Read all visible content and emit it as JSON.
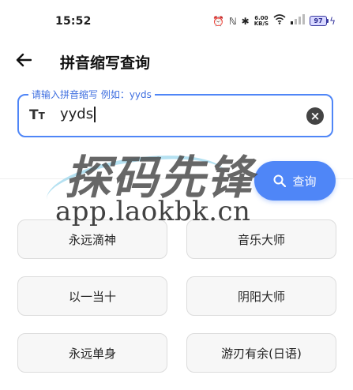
{
  "status_bar": {
    "time": "15:52",
    "network_speed": "6.00\nKB/S",
    "battery": "97"
  },
  "header": {
    "title": "拼音缩写查询",
    "back_icon": "arrow-left-icon"
  },
  "search": {
    "label": "请输入拼音缩写 例如：yyds",
    "value": "yyds",
    "leading_icon": "text-size-icon",
    "clear_icon": "clear-circle-icon"
  },
  "query_button": {
    "label": "查询",
    "icon": "search-icon"
  },
  "results": [
    [
      "永远滴神",
      "音乐大师"
    ],
    [
      "以一当十",
      "阴阳大师"
    ],
    [
      "永远单身",
      "游刃有余(日语)"
    ]
  ],
  "watermark": {
    "title": "探码先锋",
    "url": "app.laokbk.cn"
  },
  "colors": {
    "accent": "#4f86f7"
  }
}
